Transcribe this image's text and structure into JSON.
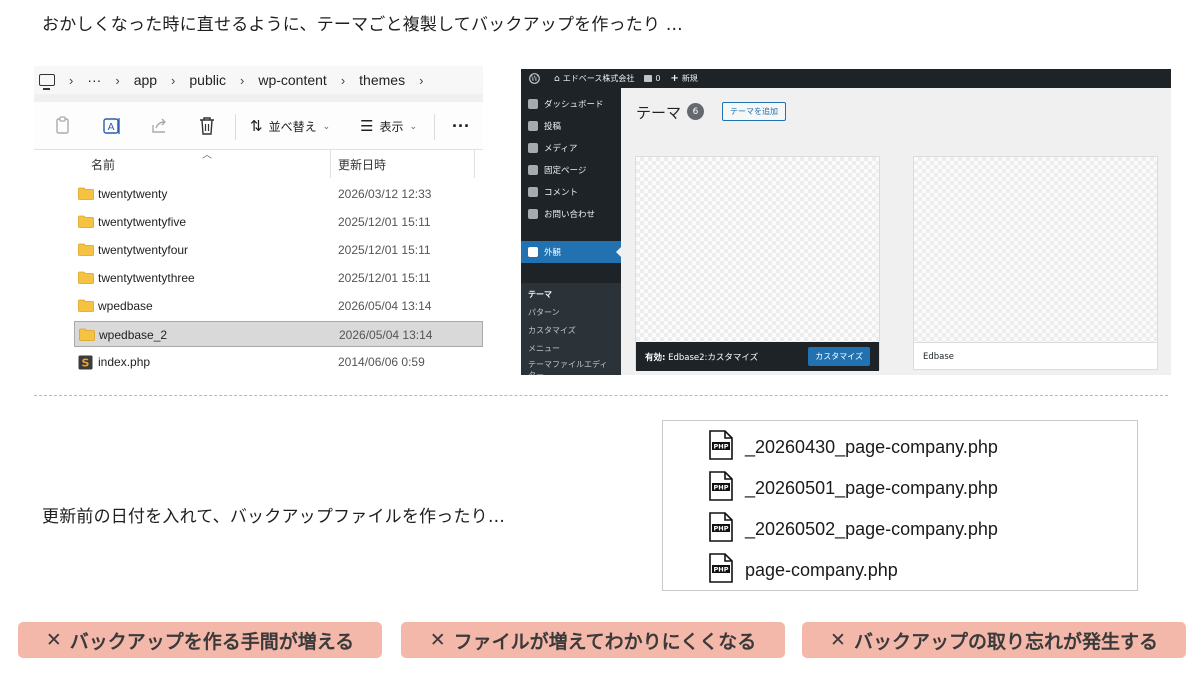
{
  "captions": {
    "top": "おかしくなった時に直せるように、テーマごと複製してバックアップを作ったり …",
    "middle": "更新前の日付を入れて、バックアップファイルを作ったり…"
  },
  "explorer": {
    "breadcrumb": [
      "app",
      "public",
      "wp-content",
      "themes"
    ],
    "breadcrumb_more": "···",
    "toolbar": {
      "sort_label": "並べ替え",
      "view_label": "表示",
      "more_label": "···"
    },
    "columns": {
      "name": "名前",
      "modified": "更新日時"
    },
    "rows": [
      {
        "name": "twentytwenty",
        "date": "2026/03/12 12:33",
        "type": "folder"
      },
      {
        "name": "twentytwentyfive",
        "date": "2025/12/01 15:11",
        "type": "folder"
      },
      {
        "name": "twentytwentyfour",
        "date": "2025/12/01 15:11",
        "type": "folder"
      },
      {
        "name": "twentytwentythree",
        "date": "2025/12/01 15:11",
        "type": "folder"
      },
      {
        "name": "wpedbase",
        "date": "2026/05/04 13:14",
        "type": "folder"
      },
      {
        "name": "wpedbase_2",
        "date": "2026/05/04 13:14",
        "type": "folder",
        "selected": true
      },
      {
        "name": "index.php",
        "date": "2014/06/06 0:59",
        "type": "php"
      }
    ]
  },
  "wordpress": {
    "admin_bar": {
      "site_name": "エドベース株式会社",
      "comments": "0",
      "new_label": "新規"
    },
    "menu": [
      {
        "label": "ダッシュボード",
        "icon": "dashboard-icon"
      },
      {
        "label": "投稿",
        "icon": "pin-icon"
      },
      {
        "label": "メディア",
        "icon": "media-icon"
      },
      {
        "label": "固定ページ",
        "icon": "page-icon"
      },
      {
        "label": "コメント",
        "icon": "comment-icon"
      },
      {
        "label": "お問い合わせ",
        "icon": "mail-icon"
      },
      {
        "label": "外観",
        "icon": "brush-icon",
        "active": true
      }
    ],
    "submenu": [
      "テーマ",
      "パターン",
      "カスタマイズ",
      "メニュー",
      "テーマファイルエディター"
    ],
    "page_title": "テーマ",
    "theme_count": "6",
    "add_theme_label": "テーマを追加",
    "active_theme": {
      "prefix": "有効:",
      "name": "Edbase2:カスタマイズ",
      "button": "カスタマイズ"
    },
    "other_theme": {
      "name": "Edbase"
    }
  },
  "files": [
    "_20260430_page-company.php",
    "_20260501_page-company.php",
    "_20260502_page-company.php",
    "page-company.php"
  ],
  "file_icon_label": "PHP",
  "tags": [
    "バックアップを作る手間が増える",
    "ファイルが増えてわかりにくくなる",
    "バックアップの取り忘れが発生する"
  ],
  "tag_mark": "✕",
  "colors": {
    "tag_bg": "#f4b8ab",
    "wp_dark": "#1d2327",
    "wp_blue": "#2271b1",
    "folder": "#f5c242"
  }
}
